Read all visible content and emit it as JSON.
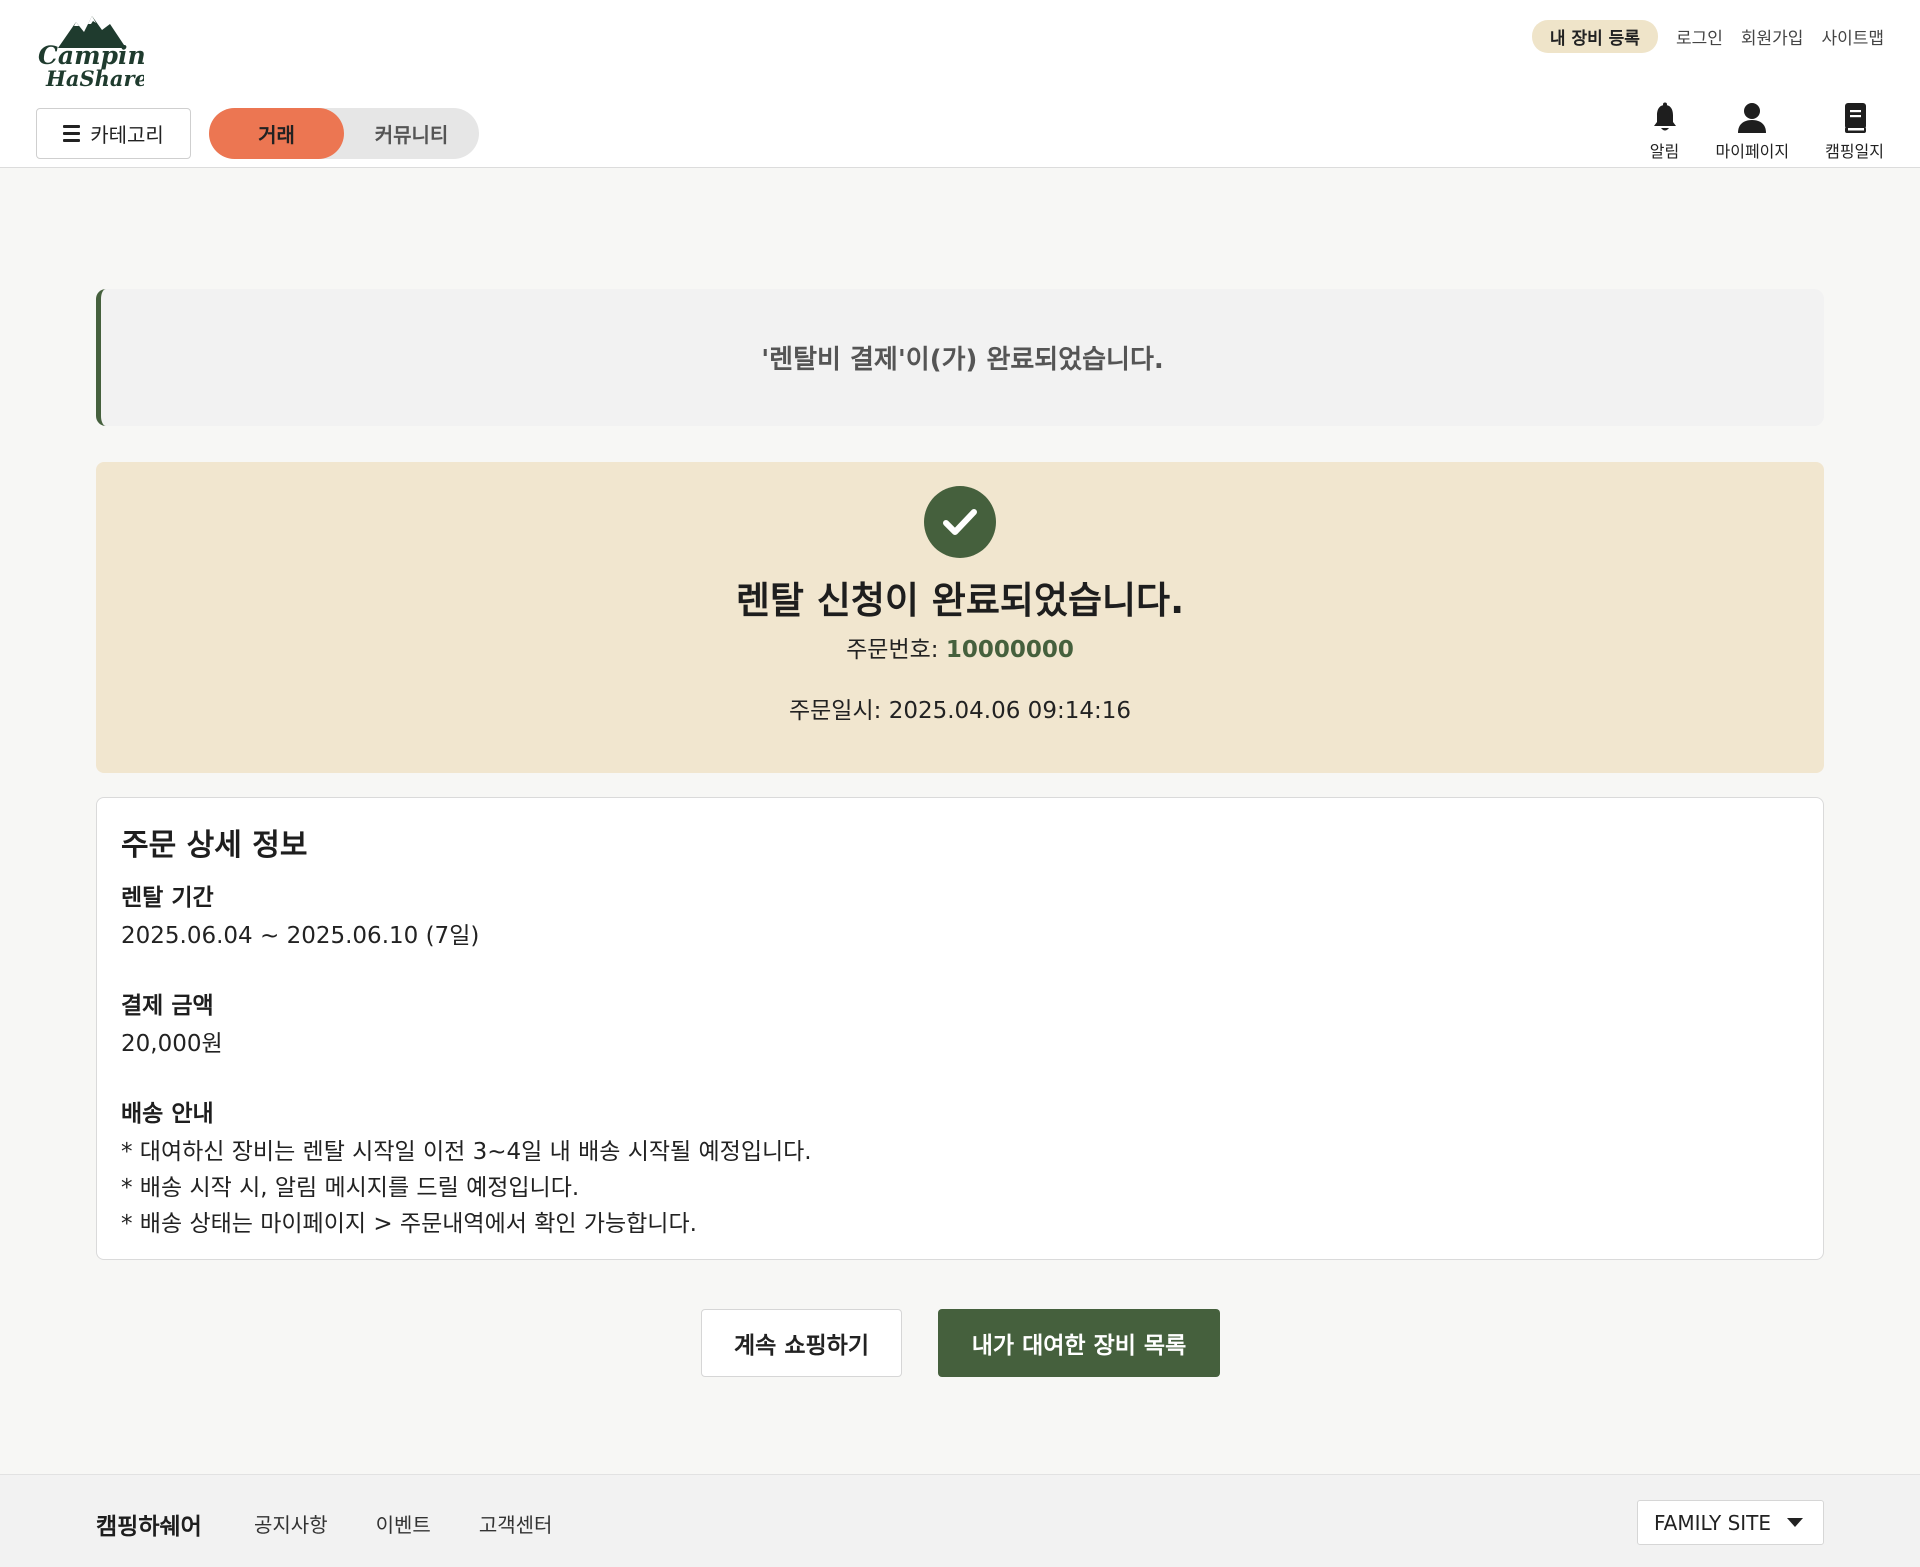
{
  "header": {
    "logo_line1": "Camping",
    "logo_line2": "HaShare",
    "top_links": {
      "register_gear": "내 장비 등록",
      "login": "로그인",
      "signup": "회원가입",
      "sitemap": "사이트맵"
    },
    "category_label": "카테고리",
    "tabs": [
      {
        "label": "거래",
        "active": true
      },
      {
        "label": "커뮤니티",
        "active": false
      }
    ],
    "icons": [
      {
        "icon": "bell-icon",
        "label": "알림"
      },
      {
        "icon": "user-icon",
        "label": "마이페이지"
      },
      {
        "icon": "book-icon",
        "label": "캠핑일지"
      }
    ]
  },
  "notice": {
    "text": "'렌탈비 결제'이(가) 완료되었습니다."
  },
  "complete": {
    "icon": "check-icon",
    "title": "렌탈 신청이 완료되었습니다.",
    "order_no_label": "주문번호: ",
    "order_no": "10000000",
    "order_date_label": "주문일시: ",
    "order_date": "2025.04.06 09:14:16"
  },
  "detail": {
    "title": "주문 상세 정보",
    "period_title": "렌탈 기간",
    "period": "2025.06.04 ~ 2025.06.10 (7일)",
    "amount_title": "결제 금액",
    "amount": "20,000원",
    "delivery_title": "배송 안내",
    "delivery_lines": [
      "* 대여하신 장비는 렌탈 시작일 이전 3~4일 내 배송 시작될 예정입니다.",
      "* 배송 시작 시, 알림 메시지를 드릴 예정입니다.",
      "* 배송 상태는 마이페이지 > 주문내역에서 확인 가능합니다."
    ]
  },
  "buttons": {
    "continue_shopping": "계속 쇼핑하기",
    "my_rentals": "내가 대여한 장비 목록"
  },
  "footer": {
    "brand": "캠핑하쉐어",
    "links": [
      "공지사항",
      "이벤트",
      "고객센터"
    ],
    "family_site": "FAMILY SITE"
  },
  "colors": {
    "accent_green": "#45603d",
    "accent_orange": "#ec7652",
    "cream": "#f1e6cf"
  }
}
